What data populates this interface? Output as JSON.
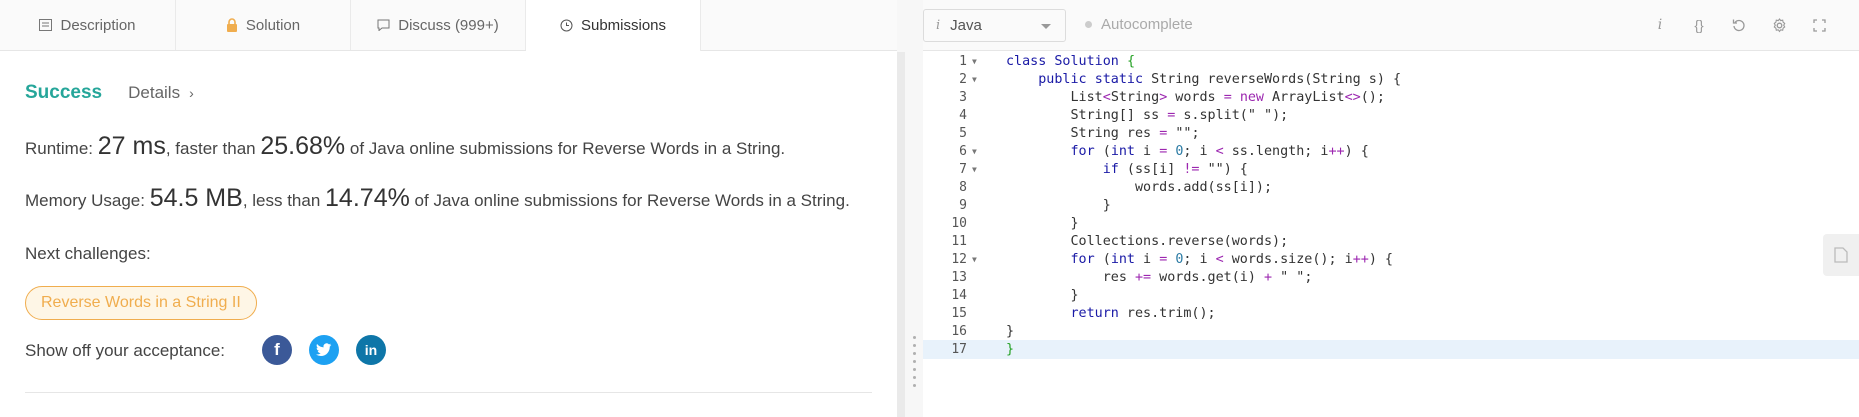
{
  "tabs": [
    {
      "label": "Description",
      "icon": "description-icon"
    },
    {
      "label": "Solution",
      "icon": "lock-icon"
    },
    {
      "label": "Discuss (999+)",
      "icon": "discuss-icon"
    },
    {
      "label": "Submissions",
      "icon": "clock-icon"
    }
  ],
  "result": {
    "status": "Success",
    "details_label": "Details",
    "runtime_label": "Runtime: ",
    "runtime_value": "27 ms",
    "runtime_mid": ", faster than ",
    "runtime_pct": "25.68%",
    "runtime_tail": " of Java online submissions for Reverse Words in a String.",
    "memory_label": "Memory Usage: ",
    "memory_value": "54.5 MB",
    "memory_mid": ", less than ",
    "memory_pct": "14.74%",
    "memory_tail": " of Java online submissions for Reverse Words in a String.",
    "next_label": "Next challenges:",
    "next_challenge": "Reverse Words in a String II",
    "share_label": "Show off your acceptance:"
  },
  "social": {
    "facebook": "f",
    "linkedin": "in"
  },
  "editor": {
    "language": "Java",
    "autocomplete_label": "Autocomplete",
    "toolbar_icons": [
      "info-icon",
      "braces-icon",
      "reset-icon",
      "settings-icon",
      "fullscreen-icon"
    ],
    "lines": [
      {
        "n": "1",
        "fold": true
      },
      {
        "n": "2",
        "fold": true
      },
      {
        "n": "3",
        "fold": false
      },
      {
        "n": "4",
        "fold": false
      },
      {
        "n": "5",
        "fold": false
      },
      {
        "n": "6",
        "fold": true
      },
      {
        "n": "7",
        "fold": true
      },
      {
        "n": "8",
        "fold": false
      },
      {
        "n": "9",
        "fold": false
      },
      {
        "n": "10",
        "fold": false
      },
      {
        "n": "11",
        "fold": false
      },
      {
        "n": "12",
        "fold": true
      },
      {
        "n": "13",
        "fold": false
      },
      {
        "n": "14",
        "fold": false
      },
      {
        "n": "15",
        "fold": false
      },
      {
        "n": "16",
        "fold": false
      },
      {
        "n": "17",
        "fold": false
      }
    ],
    "code": [
      "class Solution {",
      "    public static String reverseWords(String s) {",
      "        List<String> words = new ArrayList<>();",
      "        String[] ss = s.split(\" \");",
      "        String res = \"\";",
      "        for (int i = 0; i < ss.length; i++) {",
      "            if (ss[i] != \"\") {",
      "                words.add(ss[i]);",
      "            }",
      "        }",
      "        Collections.reverse(words);",
      "        for (int i = 0; i < words.size(); i++) {",
      "            res += words.get(i) + \" \";",
      "        }",
      "        return res.trim();",
      "}",
      "}"
    ],
    "highlighted_line": 17
  }
}
